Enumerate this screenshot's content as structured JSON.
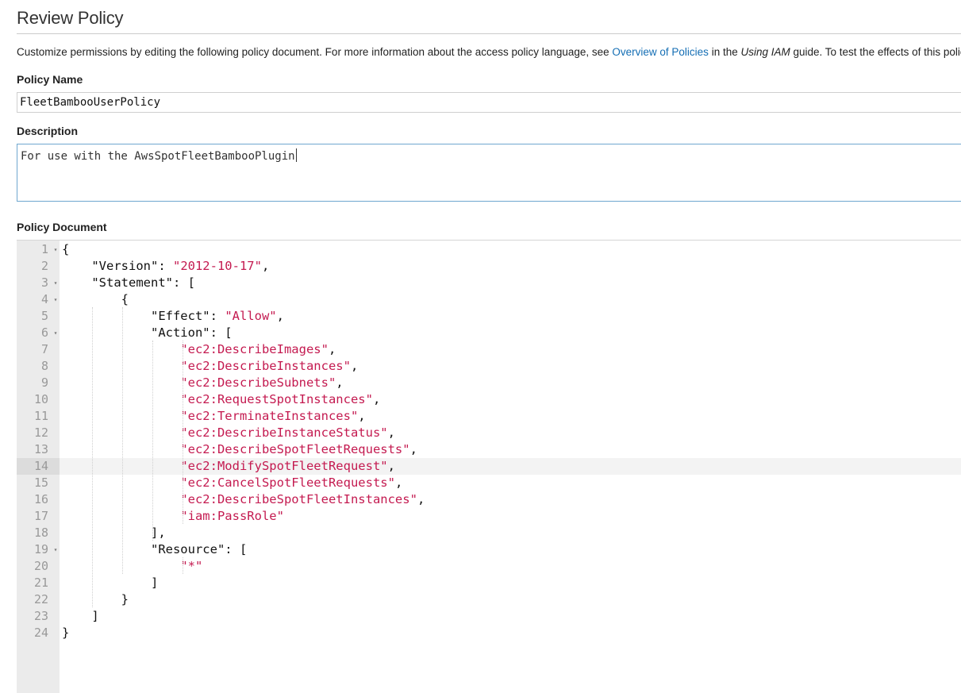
{
  "page": {
    "title": "Review Policy",
    "intro_text_1": "Customize permissions by editing the following policy document. For more information about the access policy language, see ",
    "intro_link": "Overview of Policies",
    "intro_text_2": " in the ",
    "intro_italic": "Using IAM",
    "intro_text_3": " guide. To test the effects of this policy before applying your changes, use the IAM Policy Simulator."
  },
  "form": {
    "policy_name_label": "Policy Name",
    "policy_name_value": "FleetBambooUserPolicy",
    "description_label": "Description",
    "description_value": "For use with the AwsSpotFleetBambooPlugin",
    "policy_document_label": "Policy Document"
  },
  "editor": {
    "active_line": 14,
    "lines": [
      {
        "n": "1",
        "fold": true,
        "tokens": [
          [
            "p",
            "{"
          ]
        ]
      },
      {
        "n": "2",
        "fold": false,
        "tokens": [
          [
            "p",
            "    \"Version\": "
          ],
          [
            "s",
            "\"2012-10-17\""
          ],
          [
            "p",
            ","
          ]
        ]
      },
      {
        "n": "3",
        "fold": true,
        "tokens": [
          [
            "p",
            "    \"Statement\": ["
          ]
        ]
      },
      {
        "n": "4",
        "fold": true,
        "tokens": [
          [
            "p",
            "        {"
          ]
        ]
      },
      {
        "n": "5",
        "fold": false,
        "tokens": [
          [
            "p",
            "            \"Effect\": "
          ],
          [
            "s",
            "\"Allow\""
          ],
          [
            "p",
            ","
          ]
        ]
      },
      {
        "n": "6",
        "fold": true,
        "tokens": [
          [
            "p",
            "            \"Action\": ["
          ]
        ]
      },
      {
        "n": "7",
        "fold": false,
        "tokens": [
          [
            "p",
            "                "
          ],
          [
            "s",
            "\"ec2:DescribeImages\""
          ],
          [
            "p",
            ","
          ]
        ]
      },
      {
        "n": "8",
        "fold": false,
        "tokens": [
          [
            "p",
            "                "
          ],
          [
            "s",
            "\"ec2:DescribeInstances\""
          ],
          [
            "p",
            ","
          ]
        ]
      },
      {
        "n": "9",
        "fold": false,
        "tokens": [
          [
            "p",
            "                "
          ],
          [
            "s",
            "\"ec2:DescribeSubnets\""
          ],
          [
            "p",
            ","
          ]
        ]
      },
      {
        "n": "10",
        "fold": false,
        "tokens": [
          [
            "p",
            "                "
          ],
          [
            "s",
            "\"ec2:RequestSpotInstances\""
          ],
          [
            "p",
            ","
          ]
        ]
      },
      {
        "n": "11",
        "fold": false,
        "tokens": [
          [
            "p",
            "                "
          ],
          [
            "s",
            "\"ec2:TerminateInstances\""
          ],
          [
            "p",
            ","
          ]
        ]
      },
      {
        "n": "12",
        "fold": false,
        "tokens": [
          [
            "p",
            "                "
          ],
          [
            "s",
            "\"ec2:DescribeInstanceStatus\""
          ],
          [
            "p",
            ","
          ]
        ]
      },
      {
        "n": "13",
        "fold": false,
        "tokens": [
          [
            "p",
            "                "
          ],
          [
            "s",
            "\"ec2:DescribeSpotFleetRequests\""
          ],
          [
            "p",
            ","
          ]
        ]
      },
      {
        "n": "14",
        "fold": false,
        "tokens": [
          [
            "p",
            "                "
          ],
          [
            "s",
            "\"ec2:ModifySpotFleetRequest\""
          ],
          [
            "p",
            ","
          ]
        ]
      },
      {
        "n": "15",
        "fold": false,
        "tokens": [
          [
            "p",
            "                "
          ],
          [
            "s",
            "\"ec2:CancelSpotFleetRequests\""
          ],
          [
            "p",
            ","
          ]
        ]
      },
      {
        "n": "16",
        "fold": false,
        "tokens": [
          [
            "p",
            "                "
          ],
          [
            "s",
            "\"ec2:DescribeSpotFleetInstances\""
          ],
          [
            "p",
            ","
          ]
        ]
      },
      {
        "n": "17",
        "fold": false,
        "tokens": [
          [
            "p",
            "                "
          ],
          [
            "s",
            "\"iam:PassRole\""
          ]
        ]
      },
      {
        "n": "18",
        "fold": false,
        "tokens": [
          [
            "p",
            "            ],"
          ]
        ]
      },
      {
        "n": "19",
        "fold": true,
        "tokens": [
          [
            "p",
            "            \"Resource\": ["
          ]
        ]
      },
      {
        "n": "20",
        "fold": false,
        "tokens": [
          [
            "p",
            "                "
          ],
          [
            "s",
            "\"*\""
          ]
        ]
      },
      {
        "n": "21",
        "fold": false,
        "tokens": [
          [
            "p",
            "            ]"
          ]
        ]
      },
      {
        "n": "22",
        "fold": false,
        "tokens": [
          [
            "p",
            "        }"
          ]
        ]
      },
      {
        "n": "23",
        "fold": false,
        "tokens": [
          [
            "p",
            "    ]"
          ]
        ]
      },
      {
        "n": "24",
        "fold": false,
        "tokens": [
          [
            "p",
            "}"
          ]
        ]
      }
    ]
  }
}
